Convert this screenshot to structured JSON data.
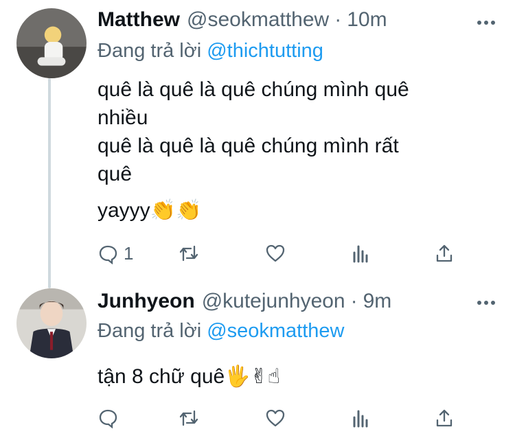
{
  "tweets": [
    {
      "name": "Matthew",
      "handle": "@seokmatthew",
      "separator": "·",
      "time": "10m",
      "reply_prefix": "Đang trả lời",
      "reply_to": "@thichtutting",
      "lines": [
        "quê là quê là quê chúng mình quê",
        "nhiều",
        "quê là quê là quê chúng mình rất",
        "quê",
        "yayyy👏👏"
      ],
      "reply_count": "1",
      "icons": [
        "reply-icon",
        "retweet-icon",
        "like-icon",
        "analytics-icon",
        "share-icon"
      ]
    },
    {
      "name": "Junhyeon",
      "handle": "@kutejunhyeon",
      "separator": "·",
      "time": "9m",
      "reply_prefix": "Đang trả lời",
      "reply_to": "@seokmatthew",
      "lines": [
        "tận 8 chữ quê🖐✌☝"
      ],
      "icons": [
        "reply-icon",
        "retweet-icon",
        "like-icon",
        "analytics-icon",
        "share-icon"
      ]
    }
  ],
  "colors": {
    "text": "#0f1419",
    "secondary": "#536471",
    "link": "#1d9bf0",
    "thread_line": "#cfd9de"
  }
}
